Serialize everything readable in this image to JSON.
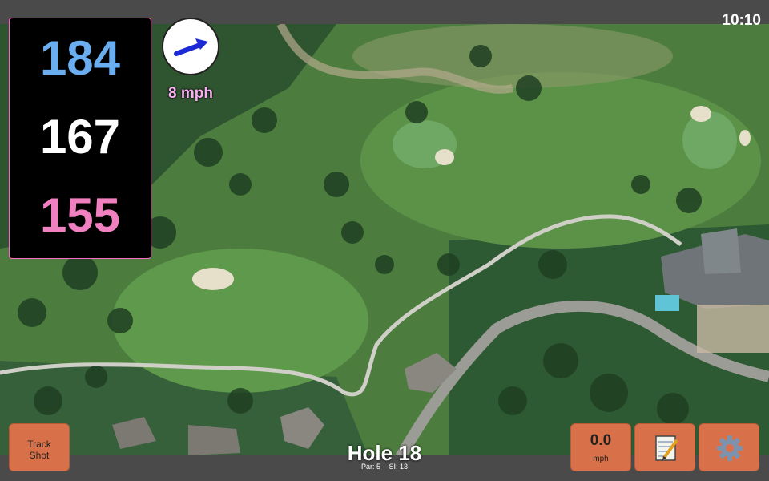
{
  "status": {
    "time": "10:10"
  },
  "distances": {
    "back": "184",
    "center": "167",
    "front": "155"
  },
  "wind": {
    "speed_label": "8 mph",
    "icon": "wind-arrow-icon"
  },
  "controls": {
    "track_shot": {
      "line1": "Track",
      "line2": "Shot"
    },
    "speed": {
      "value": "0.0",
      "unit": "mph"
    },
    "notes_icon": "notepad-icon",
    "settings_icon": "gear-icon"
  },
  "hole": {
    "title": "Hole 18",
    "par": "Par: 5",
    "si": "SI: 13"
  },
  "colors": {
    "back": "#6aaef0",
    "center": "#ffffff",
    "front": "#f080c0",
    "button": "#d8714a",
    "wind_text": "#f8b0f0"
  }
}
